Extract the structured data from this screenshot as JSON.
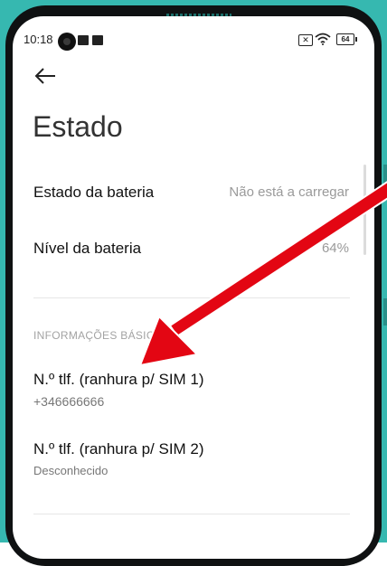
{
  "status_bar": {
    "time": "10:18",
    "battery_level": "64"
  },
  "header": {
    "back_icon": "arrow-left-icon",
    "title": "Estado"
  },
  "battery_rows": [
    {
      "label": "Estado da bateria",
      "value": "Não está a carregar"
    },
    {
      "label": "Nível da bateria",
      "value": "64%"
    }
  ],
  "basic_info": {
    "section_title": "INFORMAÇÕES BÁSICAS",
    "rows": [
      {
        "label": "N.º tlf. (ranhura p/ SIM 1)",
        "value": "+346666666"
      },
      {
        "label": "N.º tlf. (ranhura p/ SIM 2)",
        "value": "Desconhecido"
      }
    ]
  },
  "colors": {
    "phone_frame": "#36b8b0",
    "annotation_arrow": "#e30613"
  }
}
